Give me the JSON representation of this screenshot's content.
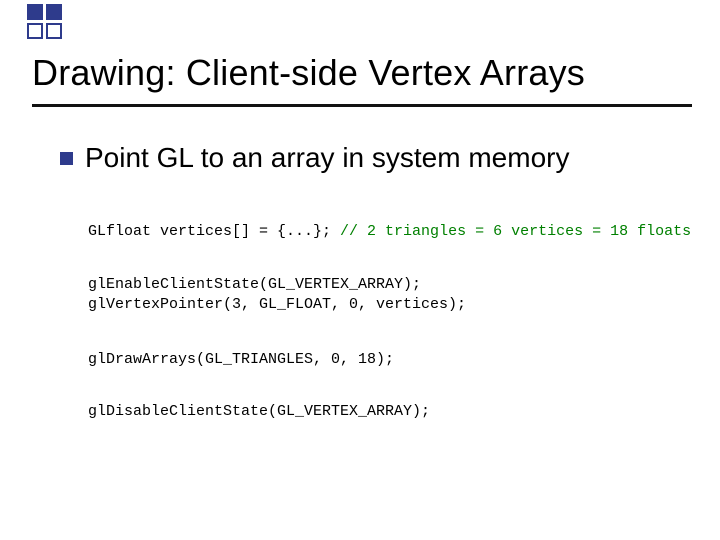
{
  "slide": {
    "title": "Drawing:  Client-side Vertex Arrays",
    "bullet": "Point GL to an array in system memory",
    "code": {
      "line1_pre": "GLfloat vertices[] = {...}; ",
      "line1_comment": "// 2 triangles = 6 vertices = 18 floats",
      "block2_l1": "glEnableClientState(GL_VERTEX_ARRAY);",
      "block2_l2": "glVertexPointer(3, GL_FLOAT, 0, vertices);",
      "block3": "glDrawArrays(GL_TRIANGLES, 0, 18);",
      "block4": "glDisableClientState(GL_VERTEX_ARRAY);"
    }
  }
}
